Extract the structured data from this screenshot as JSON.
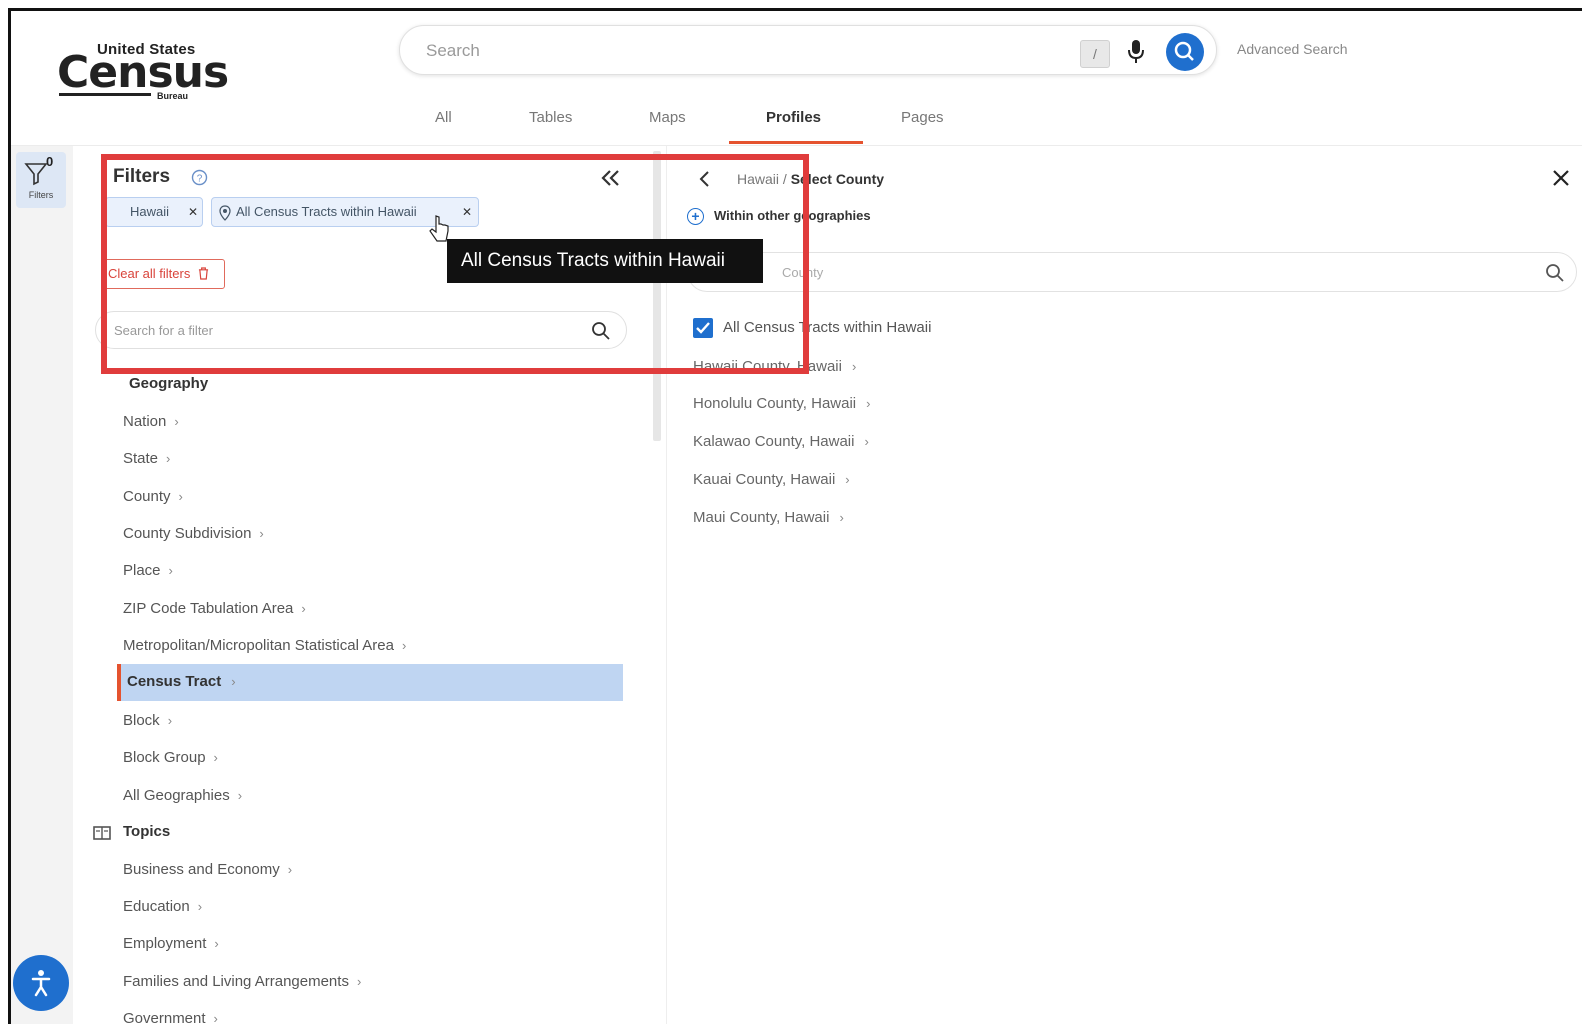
{
  "logo": {
    "top": "United States",
    "name": "Census",
    "bottom": "Bureau"
  },
  "search": {
    "placeholder": "Search",
    "shortcut_key": "/",
    "advanced_label": "Advanced Search"
  },
  "tabs": [
    "All",
    "Tables",
    "Maps",
    "Profiles",
    "Pages"
  ],
  "active_tab": "Profiles",
  "rail": {
    "filters_label": "Filters",
    "filter_count": "0"
  },
  "filters": {
    "title": "Filters",
    "chips": [
      {
        "label": "Hawaii"
      },
      {
        "label": "All Census Tracts within Hawaii"
      }
    ],
    "clear_label": "Clear all filters",
    "search_placeholder": "Search for a filter",
    "geography_heading": "Geography",
    "geography_items": [
      "Nation",
      "State",
      "County",
      "County Subdivision",
      "Place",
      "ZIP Code Tabulation Area",
      "Metropolitan/Micropolitan Statistical Area",
      "Census Tract",
      "Block",
      "Block Group",
      "All Geographies"
    ],
    "selected_item": "Census Tract",
    "topics_heading": "Topics",
    "topic_items": [
      "Business and Economy",
      "Education",
      "Employment",
      "Families and Living Arrangements",
      "Government"
    ]
  },
  "tooltip": {
    "text": "All Census Tracts within Hawaii"
  },
  "right_pane": {
    "breadcrumb_parent": "Hawaii",
    "breadcrumb_current": "Select County",
    "within_label": "Within other geographies",
    "search_placeholder": "County",
    "all_checkbox_label": "All Census Tracts within Hawaii",
    "all_checked": true,
    "counties": [
      "Hawaii County, Hawaii",
      "Honolulu County, Hawaii",
      "Kalawao County, Hawaii",
      "Kauai County, Hawaii",
      "Maui County, Hawaii"
    ]
  },
  "colors": {
    "accent": "#1f6fce",
    "highlight": "#e03c3c",
    "tab_underline": "#e5532f",
    "selected_bg": "#bfd5f2"
  }
}
